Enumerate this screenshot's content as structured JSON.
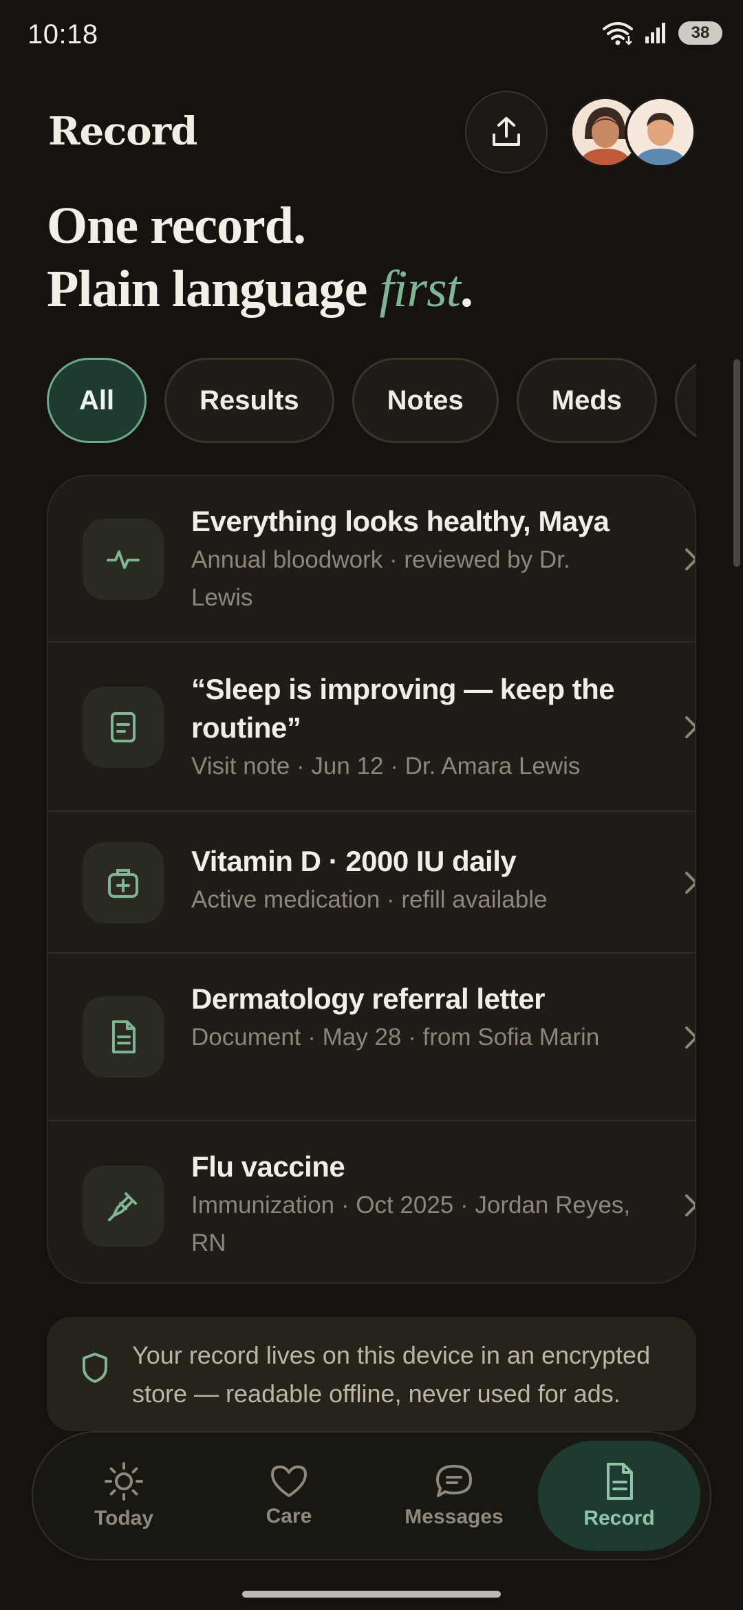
{
  "status": {
    "time": "10:18",
    "battery": "38"
  },
  "header": {
    "title": "Record"
  },
  "hero": {
    "line1": "One record.",
    "line2_prefix": "Plain language ",
    "line2_emph": "first",
    "line2_suffix": "."
  },
  "filters": [
    "All",
    "Results",
    "Notes",
    "Meds",
    ""
  ],
  "records": [
    {
      "icon": "activity-icon",
      "title": "Everything looks healthy, Maya",
      "subtitle": "Annual bloodwork · reviewed by Dr. Lewis"
    },
    {
      "icon": "note-icon",
      "title": "“Sleep is improving — keep the routine”",
      "subtitle": "Visit note · Jun 12 · Dr. Amara Lewis"
    },
    {
      "icon": "medkit-icon",
      "title": "Vitamin D · 2000 IU daily",
      "subtitle": "Active medication · refill available"
    },
    {
      "icon": "document-icon",
      "title": "Dermatology referral letter",
      "subtitle": "Document · May 28 · from Sofia Marin"
    },
    {
      "icon": "syringe-icon",
      "title": "Flu vaccine",
      "subtitle": "Immunization · Oct 2025 · Jordan Reyes, RN"
    }
  ],
  "privacy": {
    "text": "Your record lives on this device in an encrypted store — readable offline, never used for ads."
  },
  "nav": [
    {
      "label": "Today",
      "icon": "sun-icon"
    },
    {
      "label": "Care",
      "icon": "heart-icon"
    },
    {
      "label": "Messages",
      "icon": "chat-icon"
    },
    {
      "label": "Record",
      "icon": "document-icon"
    }
  ],
  "colors": {
    "accent": "#7fb596",
    "background": "#15120f",
    "card": "#1f1b17"
  }
}
